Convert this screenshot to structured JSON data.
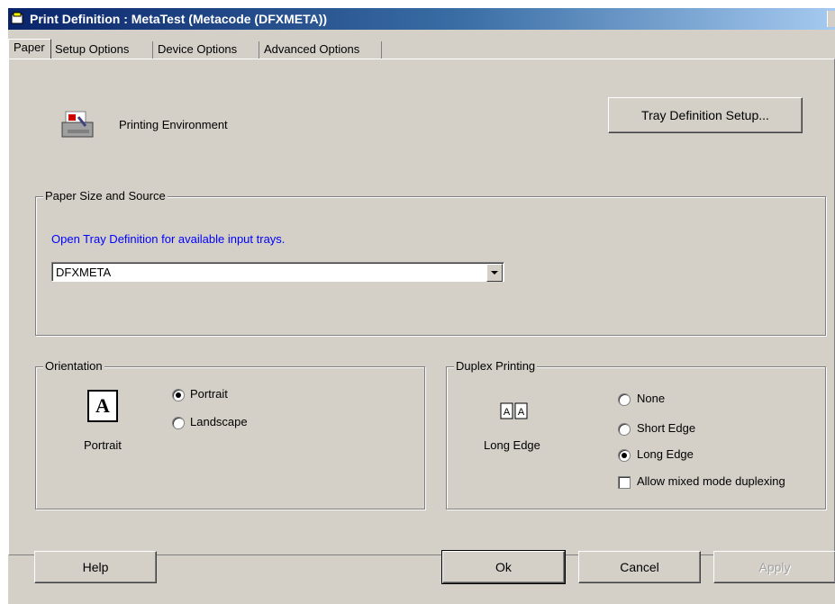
{
  "window": {
    "title": "Print Definition : MetaTest (Metacode (DFXMETA))"
  },
  "tabs": [
    {
      "label": "Paper",
      "active": true
    },
    {
      "label": "Setup Options"
    },
    {
      "label": "Device Options"
    },
    {
      "label": "Advanced Options"
    }
  ],
  "header": {
    "label": "Printing Environment",
    "icon": "printer-icon",
    "tray_button": "Tray Definition Setup..."
  },
  "paper_source": {
    "legend": "Paper Size and Source",
    "link_text": "Open Tray Definition for available input trays.",
    "link_color": "#0000ff",
    "selected_tray": "DFXMETA"
  },
  "orientation": {
    "legend": "Orientation",
    "preview_glyph": "A",
    "preview_label": "Portrait",
    "options": [
      {
        "label": "Portrait",
        "checked": true
      },
      {
        "label": "Landscape",
        "checked": false
      }
    ]
  },
  "duplex": {
    "legend": "Duplex Printing",
    "preview_glyph": "A|A",
    "preview_label": "Long Edge",
    "options": [
      {
        "label": "None",
        "checked": false
      },
      {
        "label": "Short Edge",
        "checked": false
      },
      {
        "label": "Long Edge",
        "checked": true
      }
    ],
    "mixed_mode_label": "Allow mixed mode duplexing",
    "mixed_mode_checked": false
  },
  "buttons": {
    "help": "Help",
    "ok": "Ok",
    "cancel": "Cancel",
    "apply": "Apply"
  }
}
